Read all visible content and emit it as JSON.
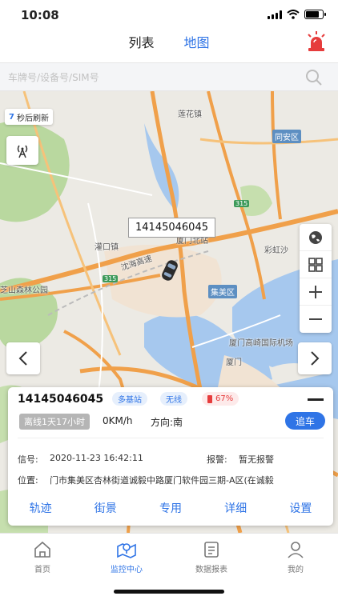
{
  "status_bar": {
    "time": "10:08"
  },
  "header": {
    "tabs": [
      {
        "label": "列表",
        "active": false
      },
      {
        "label": "地图",
        "active": true
      }
    ],
    "alarm_icon": "siren-icon"
  },
  "search": {
    "placeholder": "车牌号/设备号/SIM号",
    "icon": "search-icon"
  },
  "map": {
    "refresh_count": "7",
    "refresh_text": "秒后刷新",
    "vehicle_label": "14145046045",
    "labels": {
      "lianhua": "莲花镇",
      "tongan": "同安区",
      "guankou": "灌口镇",
      "xiamen_north": "厦门北站",
      "caihongsha": "彩虹沙",
      "jimei": "集美区",
      "senlin": "芝山森林公园",
      "airport": "厦门高崎国际机场",
      "xiamen": "厦门",
      "highway": "沈海高速",
      "r315a": "315",
      "r315b": "315"
    }
  },
  "card": {
    "plate": "14145046045",
    "badge_base": "多基站",
    "badge_wireless": "无线",
    "battery": "67%",
    "offline": "离线1天17小时",
    "speed": "0KM/h",
    "direction": "方向:南",
    "chase": "追车",
    "signal_label": "信号:",
    "signal_value": "2020-11-23 16:42:11",
    "alarm_label": "报警:",
    "alarm_value": "暂无报警",
    "position_label": "位置:",
    "position_value": "门市集美区杏林街道诚毅中路厦门软件园三期-A区(在诚毅",
    "actions": [
      "轨迹",
      "街景",
      "专用",
      "详细",
      "设置"
    ]
  },
  "bottom_nav": [
    {
      "label": "首页",
      "icon": "home-icon",
      "active": false
    },
    {
      "label": "监控中心",
      "icon": "monitor-map-icon",
      "active": true
    },
    {
      "label": "数据报表",
      "icon": "report-icon",
      "active": false
    },
    {
      "label": "我的",
      "icon": "user-icon",
      "active": false
    }
  ],
  "colors": {
    "accent": "#2f74e6",
    "alarm": "#e63c3c",
    "water": "#a6c8ee",
    "green": "#a9d08e",
    "expressway": "#f0a04a"
  }
}
